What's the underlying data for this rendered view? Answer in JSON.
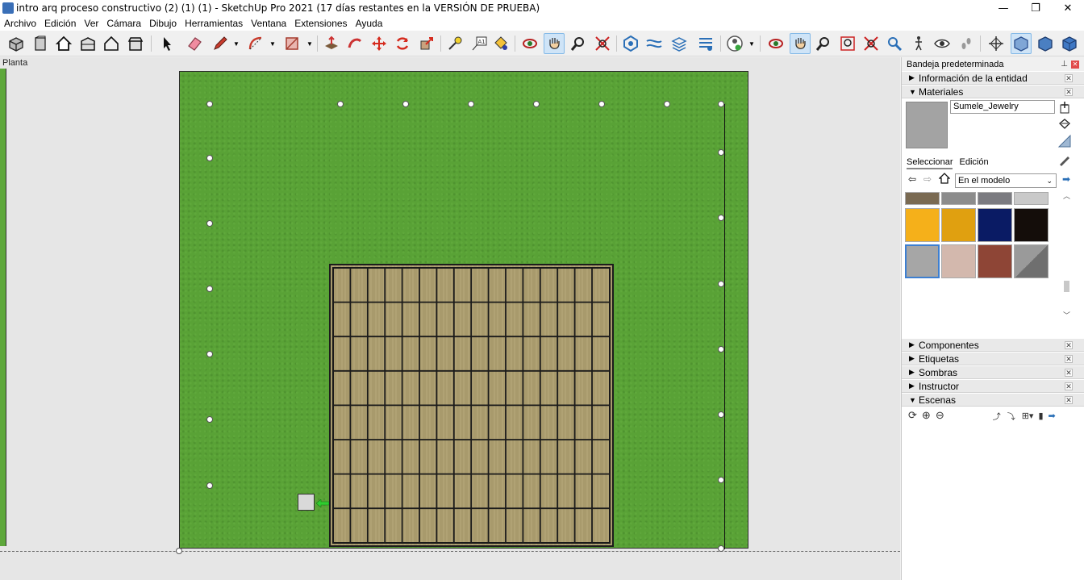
{
  "window": {
    "title": "intro arq proceso constructivo (2) (1) (1) - SketchUp Pro 2021 (17 días restantes en la VERSIÓN DE PRUEBA)",
    "minimize": "—",
    "maximize": "❐",
    "close": "✕"
  },
  "menu": [
    "Archivo",
    "Edición",
    "Ver",
    "Cámara",
    "Dibujo",
    "Herramientas",
    "Ventana",
    "Extensiones",
    "Ayuda"
  ],
  "toolbar": {
    "tools": [
      "views-iso-icon",
      "views-front-icon",
      "house-icon",
      "house-open-icon",
      "house-outline-icon",
      "house-side-icon",
      "select-arrow-icon",
      "eraser-icon",
      "pencil-icon",
      "arc-icon",
      "rectangle-icon",
      "push-pull-icon",
      "follow-me-icon",
      "move-icon",
      "rotate-icon",
      "scale-icon",
      "tape-measure-icon",
      "text-icon",
      "paint-bucket-icon",
      "orbit-icon",
      "pan-hand-icon",
      "zoom-icon",
      "zoom-extents-icon",
      "components-icon",
      "sandbox-icon",
      "layers-icon",
      "section-icon",
      "user-icon",
      "orbit-icon-2",
      "pan-hand-icon-2",
      "zoom-icon-2",
      "zoom-window-icon",
      "zoom-extents-icon-2",
      "previous-view-icon",
      "walk-icon",
      "look-around-icon",
      "footprints-icon",
      "axes-icon",
      "xray-icon",
      "back-edges-icon",
      "shaded-icon"
    ],
    "active": [
      "pan-hand-icon",
      "pan-hand-icon-2",
      "xray-icon"
    ]
  },
  "viewport": {
    "scene_label": "Planta"
  },
  "tray": {
    "title": "Bandeja predeterminada",
    "sections": {
      "entity_info": "Información de la entidad",
      "materials": "Materiales",
      "components": "Componentes",
      "tags": "Etiquetas",
      "shadows": "Sombras",
      "instructor": "Instructor",
      "scenes": "Escenas"
    },
    "materials": {
      "name": "Sumele_Jewelry",
      "tab_select": "Seleccionar",
      "tab_edit": "Edición",
      "collection": "En el modelo",
      "swatch_colors": [
        "#7a6a52",
        "#8c8c8c",
        "#7b7b80",
        "#c9c9c9",
        "#f5b01a",
        "#e0a010",
        "#0a1b64",
        "#140d0a",
        "#a6a6a6",
        "#d3b8ad",
        "#8e4536",
        "#7f7f7f"
      ]
    }
  }
}
